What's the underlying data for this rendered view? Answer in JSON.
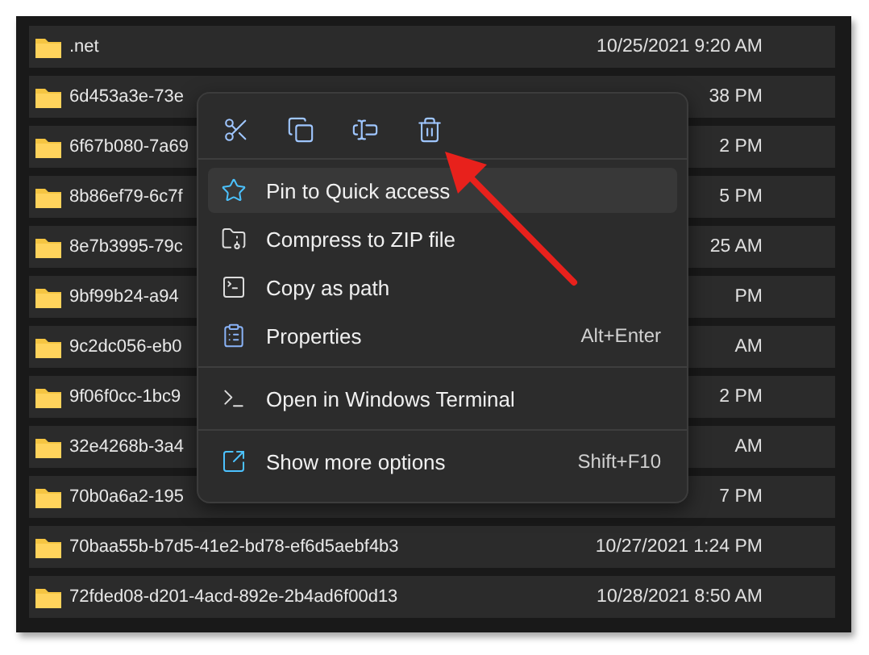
{
  "files": [
    {
      "name": ".net",
      "modified": "10/25/2021 9:20 AM"
    },
    {
      "name": "6d453a3e-73e",
      "modified": "38 PM"
    },
    {
      "name": "6f67b080-7a69",
      "modified": "2 PM"
    },
    {
      "name": "8b86ef79-6c7f",
      "modified": "5 PM"
    },
    {
      "name": "8e7b3995-79c",
      "modified": "25 AM"
    },
    {
      "name": "9bf99b24-a94",
      "modified": "PM"
    },
    {
      "name": "9c2dc056-eb0",
      "modified": "AM"
    },
    {
      "name": "9f06f0cc-1bc9",
      "modified": "2 PM"
    },
    {
      "name": "32e4268b-3a4",
      "modified": "AM"
    },
    {
      "name": "70b0a6a2-195",
      "modified": "7 PM"
    },
    {
      "name": "70baa55b-b7d5-41e2-bd78-ef6d5aebf4b3",
      "modified": "10/27/2021 1:24 PM"
    },
    {
      "name": "72fded08-d201-4acd-892e-2b4ad6f00d13",
      "modified": "10/28/2021 8:50 AM"
    }
  ],
  "context_menu": {
    "toolbar": [
      {
        "kind": "cut"
      },
      {
        "kind": "copy"
      },
      {
        "kind": "rename"
      },
      {
        "kind": "delete"
      }
    ],
    "groups": [
      [
        {
          "kind": "pin",
          "label": "Pin to Quick access",
          "selected": true
        },
        {
          "kind": "zip",
          "label": "Compress to ZIP file",
          "selected": false
        },
        {
          "kind": "path",
          "label": "Copy as path",
          "selected": false
        },
        {
          "kind": "properties",
          "label": "Properties",
          "shortcut": "Alt+Enter",
          "selected": false
        }
      ],
      [
        {
          "kind": "terminal",
          "label": "Open in Windows Terminal",
          "selected": false
        }
      ],
      [
        {
          "kind": "more",
          "label": "Show more options",
          "shortcut": "Shift+F10",
          "selected": false
        }
      ]
    ]
  }
}
